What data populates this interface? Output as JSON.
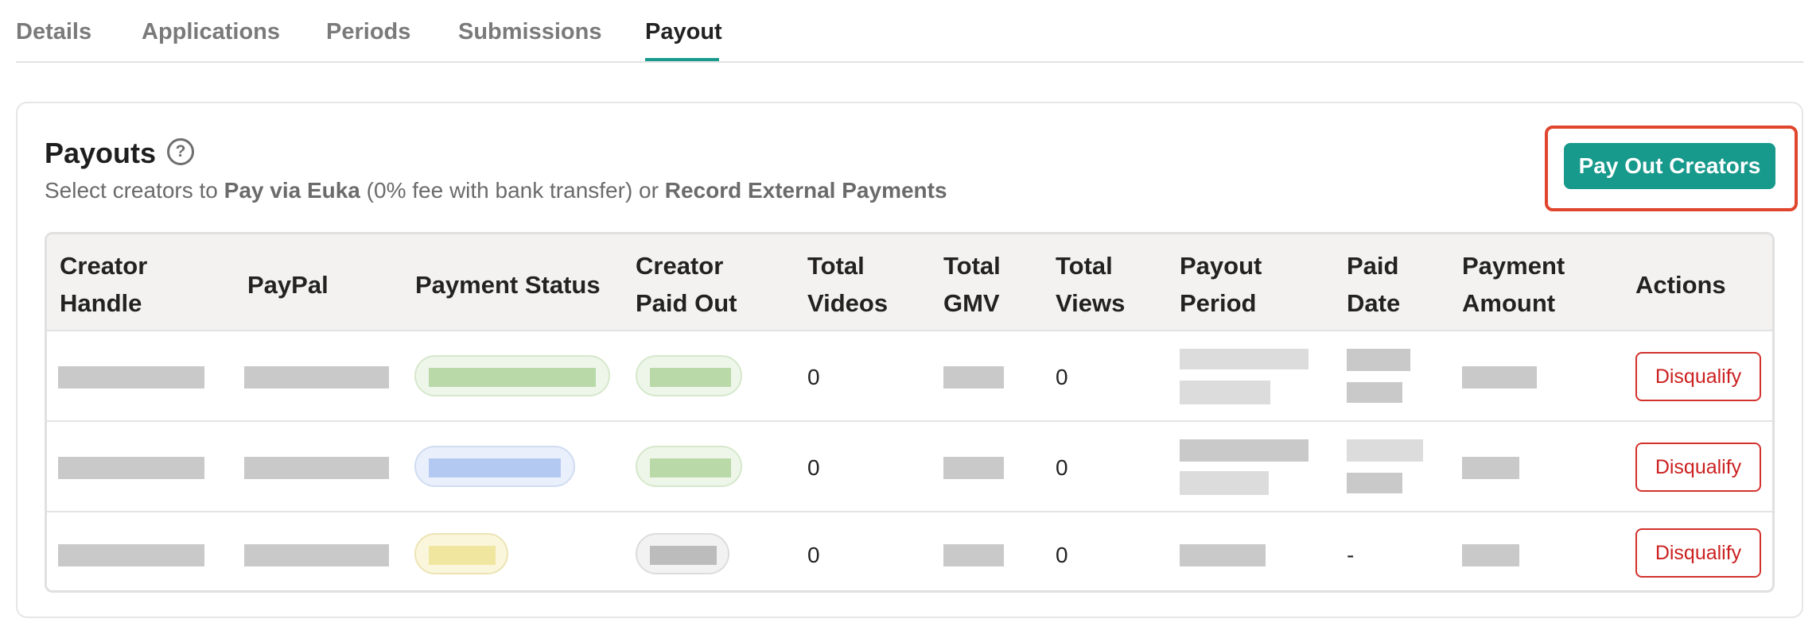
{
  "tabs": [
    {
      "label": "Details"
    },
    {
      "label": "Applications"
    },
    {
      "label": "Periods"
    },
    {
      "label": "Submissions"
    },
    {
      "label": "Payout"
    }
  ],
  "payouts": {
    "title": "Payouts",
    "help_icon": "question-circle-icon",
    "subtitle_parts": {
      "pre": "Select creators to ",
      "bold1": "Pay via Euka",
      "mid": " (0% fee with bank transfer) or ",
      "bold2": "Record External Payments"
    },
    "primary_button": "Pay Out Creators"
  },
  "table": {
    "headers": {
      "creator_handle": [
        "Creator",
        "Handle"
      ],
      "paypal": "PayPal",
      "payment_status": "Payment Status",
      "creator_paid_out": [
        "Creator",
        "Paid Out"
      ],
      "total_videos": [
        "Total",
        "Videos"
      ],
      "total_gmv": [
        "Total",
        "GMV"
      ],
      "total_views": [
        "Total",
        "Views"
      ],
      "payout_period": [
        "Payout",
        "Period"
      ],
      "paid_date": [
        "Paid",
        "Date"
      ],
      "payment_amount": [
        "Payment",
        "Amount"
      ],
      "actions": "Actions"
    },
    "rows": [
      {
        "total_videos": "0",
        "total_views": "0",
        "paid_date": "",
        "action": "Disqualify"
      },
      {
        "total_videos": "0",
        "total_views": "0",
        "paid_date": "",
        "action": "Disqualify"
      },
      {
        "total_videos": "0",
        "total_views": "0",
        "paid_date": "-",
        "action": "Disqualify"
      }
    ]
  },
  "colors": {
    "accent": "#17998c",
    "highlight": "#e0452e",
    "danger": "#cc2020",
    "status_green": "#b9d9a9",
    "status_blue": "#b4c9f2",
    "status_yellow": "#f0e6a0"
  }
}
